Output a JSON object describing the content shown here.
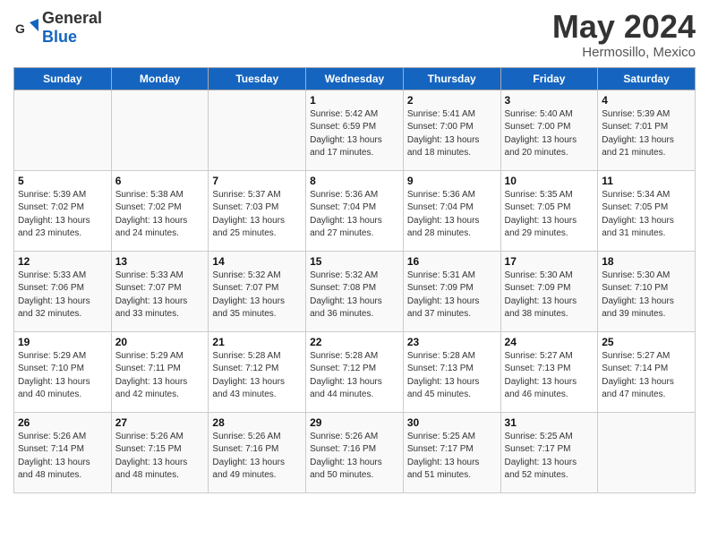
{
  "logo": {
    "general": "General",
    "blue": "Blue"
  },
  "title": "May 2024",
  "subtitle": "Hermosillo, Mexico",
  "days_of_week": [
    "Sunday",
    "Monday",
    "Tuesday",
    "Wednesday",
    "Thursday",
    "Friday",
    "Saturday"
  ],
  "weeks": [
    [
      {
        "day": "",
        "info": ""
      },
      {
        "day": "",
        "info": ""
      },
      {
        "day": "",
        "info": ""
      },
      {
        "day": "1",
        "info": "Sunrise: 5:42 AM\nSunset: 6:59 PM\nDaylight: 13 hours\nand 17 minutes."
      },
      {
        "day": "2",
        "info": "Sunrise: 5:41 AM\nSunset: 7:00 PM\nDaylight: 13 hours\nand 18 minutes."
      },
      {
        "day": "3",
        "info": "Sunrise: 5:40 AM\nSunset: 7:00 PM\nDaylight: 13 hours\nand 20 minutes."
      },
      {
        "day": "4",
        "info": "Sunrise: 5:39 AM\nSunset: 7:01 PM\nDaylight: 13 hours\nand 21 minutes."
      }
    ],
    [
      {
        "day": "5",
        "info": "Sunrise: 5:39 AM\nSunset: 7:02 PM\nDaylight: 13 hours\nand 23 minutes."
      },
      {
        "day": "6",
        "info": "Sunrise: 5:38 AM\nSunset: 7:02 PM\nDaylight: 13 hours\nand 24 minutes."
      },
      {
        "day": "7",
        "info": "Sunrise: 5:37 AM\nSunset: 7:03 PM\nDaylight: 13 hours\nand 25 minutes."
      },
      {
        "day": "8",
        "info": "Sunrise: 5:36 AM\nSunset: 7:04 PM\nDaylight: 13 hours\nand 27 minutes."
      },
      {
        "day": "9",
        "info": "Sunrise: 5:36 AM\nSunset: 7:04 PM\nDaylight: 13 hours\nand 28 minutes."
      },
      {
        "day": "10",
        "info": "Sunrise: 5:35 AM\nSunset: 7:05 PM\nDaylight: 13 hours\nand 29 minutes."
      },
      {
        "day": "11",
        "info": "Sunrise: 5:34 AM\nSunset: 7:05 PM\nDaylight: 13 hours\nand 31 minutes."
      }
    ],
    [
      {
        "day": "12",
        "info": "Sunrise: 5:33 AM\nSunset: 7:06 PM\nDaylight: 13 hours\nand 32 minutes."
      },
      {
        "day": "13",
        "info": "Sunrise: 5:33 AM\nSunset: 7:07 PM\nDaylight: 13 hours\nand 33 minutes."
      },
      {
        "day": "14",
        "info": "Sunrise: 5:32 AM\nSunset: 7:07 PM\nDaylight: 13 hours\nand 35 minutes."
      },
      {
        "day": "15",
        "info": "Sunrise: 5:32 AM\nSunset: 7:08 PM\nDaylight: 13 hours\nand 36 minutes."
      },
      {
        "day": "16",
        "info": "Sunrise: 5:31 AM\nSunset: 7:09 PM\nDaylight: 13 hours\nand 37 minutes."
      },
      {
        "day": "17",
        "info": "Sunrise: 5:30 AM\nSunset: 7:09 PM\nDaylight: 13 hours\nand 38 minutes."
      },
      {
        "day": "18",
        "info": "Sunrise: 5:30 AM\nSunset: 7:10 PM\nDaylight: 13 hours\nand 39 minutes."
      }
    ],
    [
      {
        "day": "19",
        "info": "Sunrise: 5:29 AM\nSunset: 7:10 PM\nDaylight: 13 hours\nand 40 minutes."
      },
      {
        "day": "20",
        "info": "Sunrise: 5:29 AM\nSunset: 7:11 PM\nDaylight: 13 hours\nand 42 minutes."
      },
      {
        "day": "21",
        "info": "Sunrise: 5:28 AM\nSunset: 7:12 PM\nDaylight: 13 hours\nand 43 minutes."
      },
      {
        "day": "22",
        "info": "Sunrise: 5:28 AM\nSunset: 7:12 PM\nDaylight: 13 hours\nand 44 minutes."
      },
      {
        "day": "23",
        "info": "Sunrise: 5:28 AM\nSunset: 7:13 PM\nDaylight: 13 hours\nand 45 minutes."
      },
      {
        "day": "24",
        "info": "Sunrise: 5:27 AM\nSunset: 7:13 PM\nDaylight: 13 hours\nand 46 minutes."
      },
      {
        "day": "25",
        "info": "Sunrise: 5:27 AM\nSunset: 7:14 PM\nDaylight: 13 hours\nand 47 minutes."
      }
    ],
    [
      {
        "day": "26",
        "info": "Sunrise: 5:26 AM\nSunset: 7:14 PM\nDaylight: 13 hours\nand 48 minutes."
      },
      {
        "day": "27",
        "info": "Sunrise: 5:26 AM\nSunset: 7:15 PM\nDaylight: 13 hours\nand 48 minutes."
      },
      {
        "day": "28",
        "info": "Sunrise: 5:26 AM\nSunset: 7:16 PM\nDaylight: 13 hours\nand 49 minutes."
      },
      {
        "day": "29",
        "info": "Sunrise: 5:26 AM\nSunset: 7:16 PM\nDaylight: 13 hours\nand 50 minutes."
      },
      {
        "day": "30",
        "info": "Sunrise: 5:25 AM\nSunset: 7:17 PM\nDaylight: 13 hours\nand 51 minutes."
      },
      {
        "day": "31",
        "info": "Sunrise: 5:25 AM\nSunset: 7:17 PM\nDaylight: 13 hours\nand 52 minutes."
      },
      {
        "day": "",
        "info": ""
      }
    ]
  ]
}
